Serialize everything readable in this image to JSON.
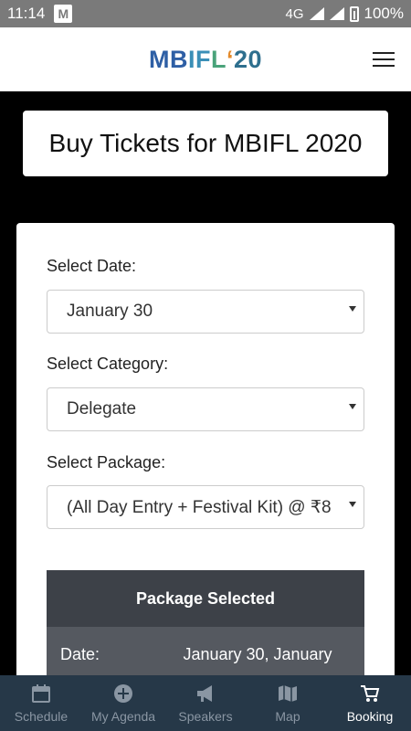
{
  "status_bar": {
    "time": "11:14",
    "notification_icon": "M",
    "network": "4G",
    "battery": "100%"
  },
  "header": {
    "logo": {
      "part1": "MB",
      "part2": "IF",
      "part3": "L",
      "apostrophe": "‘",
      "year": "20"
    },
    "menu_icon": "hamburger-icon"
  },
  "title": "Buy Tickets for MBIFL 2020",
  "form": {
    "date": {
      "label": "Select Date:",
      "value": "January 30"
    },
    "category": {
      "label": "Select Category:",
      "value": "Delegate"
    },
    "package": {
      "label": "Select Package:",
      "value": "(All Day Entry + Festival Kit) @ ₹8"
    }
  },
  "package_summary": {
    "header": "Package Selected",
    "rows": [
      {
        "key": "Date:",
        "value": "January 30, January"
      }
    ]
  },
  "bottom_nav": {
    "items": [
      {
        "label": "Schedule",
        "icon": "calendar-icon"
      },
      {
        "label": "My Agenda",
        "icon": "plus-circle-icon"
      },
      {
        "label": "Speakers",
        "icon": "megaphone-icon"
      },
      {
        "label": "Map",
        "icon": "map-icon"
      },
      {
        "label": "Booking",
        "icon": "cart-icon"
      }
    ],
    "active": "Booking"
  },
  "colors": {
    "status_bar": "#7a7a7a",
    "nav_bg": "#263848",
    "table_header": "#3d4148",
    "table_row": "#555960"
  }
}
